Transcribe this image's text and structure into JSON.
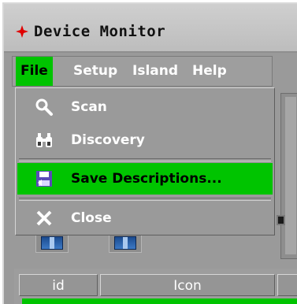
{
  "window": {
    "title": "Device Monitor"
  },
  "menubar": {
    "items": [
      "File",
      "Setup",
      "Island",
      "Help"
    ],
    "active": "File"
  },
  "file_menu": {
    "items": [
      {
        "label": "Scan",
        "icon": "magnifier-icon"
      },
      {
        "label": "Discovery",
        "icon": "binoculars-icon"
      },
      {
        "label": "Save Descriptions...",
        "icon": "save-icon",
        "selected": true
      },
      {
        "label": "Close",
        "icon": "close-x-icon"
      }
    ]
  },
  "table": {
    "columns": [
      "id",
      "Icon"
    ]
  },
  "colors": {
    "selection": "#00c400",
    "panel": "#9a9a9a",
    "title_icon": "#e00000"
  }
}
